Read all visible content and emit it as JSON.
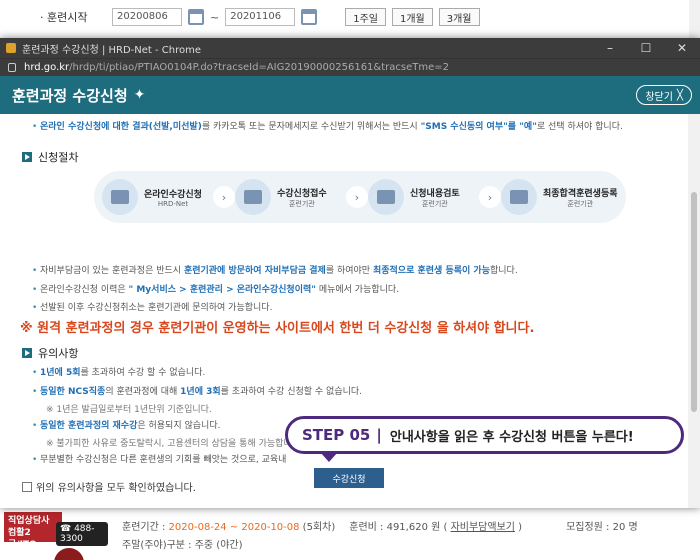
{
  "background": {
    "period_label": "· 훈련시작",
    "date_from": "20200806",
    "date_to": "20201106",
    "tilde": "~",
    "btn_1week": "1주일",
    "btn_1month": "1개월",
    "btn_3month": "3개월",
    "badge_line1": "직업상담사",
    "badge_line2": "컴활2급/ITQ",
    "badge_phone": "488-3300",
    "info_period_label": "훈련기간 : ",
    "info_period_value": "2020-08-24 ~ 2020-10-08",
    "info_count": " (5회차)",
    "info_fee_label": "훈련비 : 491,620 원 ( ",
    "info_fee_link": "자비부담액보기",
    "info_fee_close": " )",
    "info_capacity": "모집정원 : 20 명",
    "info_schedule": "주말(주야)구분 : 주중 (야간)"
  },
  "popup": {
    "window_title": "훈련과정 수강신청 | HRD-Net - Chrome",
    "address_host": "hrd.go.kr",
    "address_path": "/hrdp/ti/ptiao/PTIAO0104P.do?tracseId=AIG20190000256161&tracseTme=2",
    "header_title": "훈련과정 수강신청",
    "close_label": "창닫기",
    "online_notice_a": "온라인 수강신청에 대한 결과(선발,미선발)",
    "online_notice_b": "를 카카오톡 또는 문자메세지로 수신받기 위해서는 반드시 ",
    "online_notice_c": "\"SMS 수신동의 여부\"를 \"예\"",
    "online_notice_d": "로 선택 하셔야 합니다.",
    "section_procedure": "신청절차",
    "steps": [
      {
        "main": "온라인수강신청",
        "sub": "HRD-Net"
      },
      {
        "main": "수강신청접수",
        "sub": "훈련기관"
      },
      {
        "main": "신청내용검토",
        "sub": "훈련기관"
      },
      {
        "main": "최종합격훈련생등록",
        "sub": "훈련기관"
      }
    ],
    "self_pay_a": "자비부담금이 있는 훈련과정은 반드시 ",
    "self_pay_b": "훈련기관에 방문하여 자비부담금 결제",
    "self_pay_c": "를 하여야만 ",
    "self_pay_d": "최종적으로 훈련생 등록이 가능",
    "self_pay_e": "합니다.",
    "history_a": "온라인수강신청 이력은 ",
    "history_b": "\" My서비스 > 훈련관리 > 온라인수강신청이력\"",
    "history_c": " 메뉴에서 가능합니다.",
    "selected_notice": "선발된 이후 수강신청취소는 훈련기관에 문의하여 가능합니다.",
    "warning": "※ 원격 훈련과정의 경우 훈련기관이 운영하는 사이트에서 한번 더 수강신청 을 하셔야 합니다.",
    "section_caution": "유의사항",
    "caution1_a": "1년에 5회",
    "caution1_b": "를 초과하여 수강 할 수 없습니다.",
    "caution2_a": "동일한 NCS직종",
    "caution2_b": "의 훈련과정에 대해 ",
    "caution2_c": "1년에 3회",
    "caution2_d": "를 초과하여 수강 신청할 수 없습니다.",
    "caution2_note": "※ 1년은 발급일로부터 1년단위 기준입니다.",
    "caution3_a": "동일한 훈련과정의 재수강",
    "caution3_b": "은 허용되지 않습니다.",
    "caution3_note": "※ 불가피한 사유로 중도탈락시, 고용센터의 상담을 통해 가능합니다",
    "caution4": "무분별한 수강신청은 다른 훈련생의 기회를 빼앗는 것으로, 교육내",
    "agree_label": "위의 유의사항을 모두 확인하였습니다.",
    "apply_button": "수강신청",
    "callout_step": "STEP 05",
    "callout_sep": "|",
    "callout_text": "안내사항을 읽은 후 수강신청 버튼을 누른다!",
    "win_min": "–",
    "win_max": "☐",
    "win_close": "✕",
    "step_arrow": "›",
    "close_x": "╳"
  }
}
